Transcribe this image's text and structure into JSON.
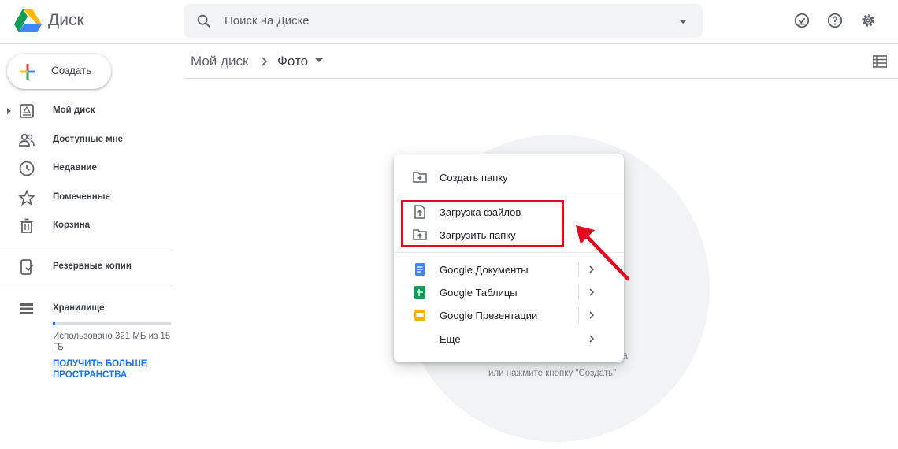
{
  "header": {
    "app_title": "Диск",
    "search": {
      "placeholder": "Поиск на Диске"
    },
    "icons": [
      "offline-check-icon",
      "help-icon",
      "settings-icon"
    ]
  },
  "sidebar": {
    "create_label": "Создать",
    "items": [
      {
        "label": "Мой диск",
        "icon": "my-drive-icon"
      },
      {
        "label": "Доступные мне",
        "icon": "shared-icon"
      },
      {
        "label": "Недавние",
        "icon": "clock-icon"
      },
      {
        "label": "Помеченные",
        "icon": "star-icon"
      },
      {
        "label": "Корзина",
        "icon": "trash-icon"
      }
    ],
    "backup_label": "Резервные копии",
    "storage": {
      "label": "Хранилище",
      "used_text": "Использовано 321 МБ из 15 ГБ",
      "used_fraction": 0.02,
      "upgrade_link": "ПОЛУЧИТЬ БОЛЬШЕ ПРОСТРАНСТВА"
    }
  },
  "breadcrumb": {
    "root": "Мой диск",
    "current": "Фото"
  },
  "empty_state": {
    "title_fragment": "да",
    "hint": "или нажмите кнопку \"Создать\""
  },
  "menu": {
    "new_folder": "Создать папку",
    "upload_files": "Загрузка файлов",
    "upload_folder": "Загрузить папку",
    "docs": "Google Документы",
    "sheets": "Google Таблицы",
    "slides": "Google Презентации",
    "more": "Ещё"
  },
  "colors": {
    "accent": "#1a73e8",
    "highlight_red": "#e10a1e",
    "docs_blue": "#4285f4",
    "sheets_green": "#0f9d58",
    "slides_yellow": "#f4b400"
  }
}
